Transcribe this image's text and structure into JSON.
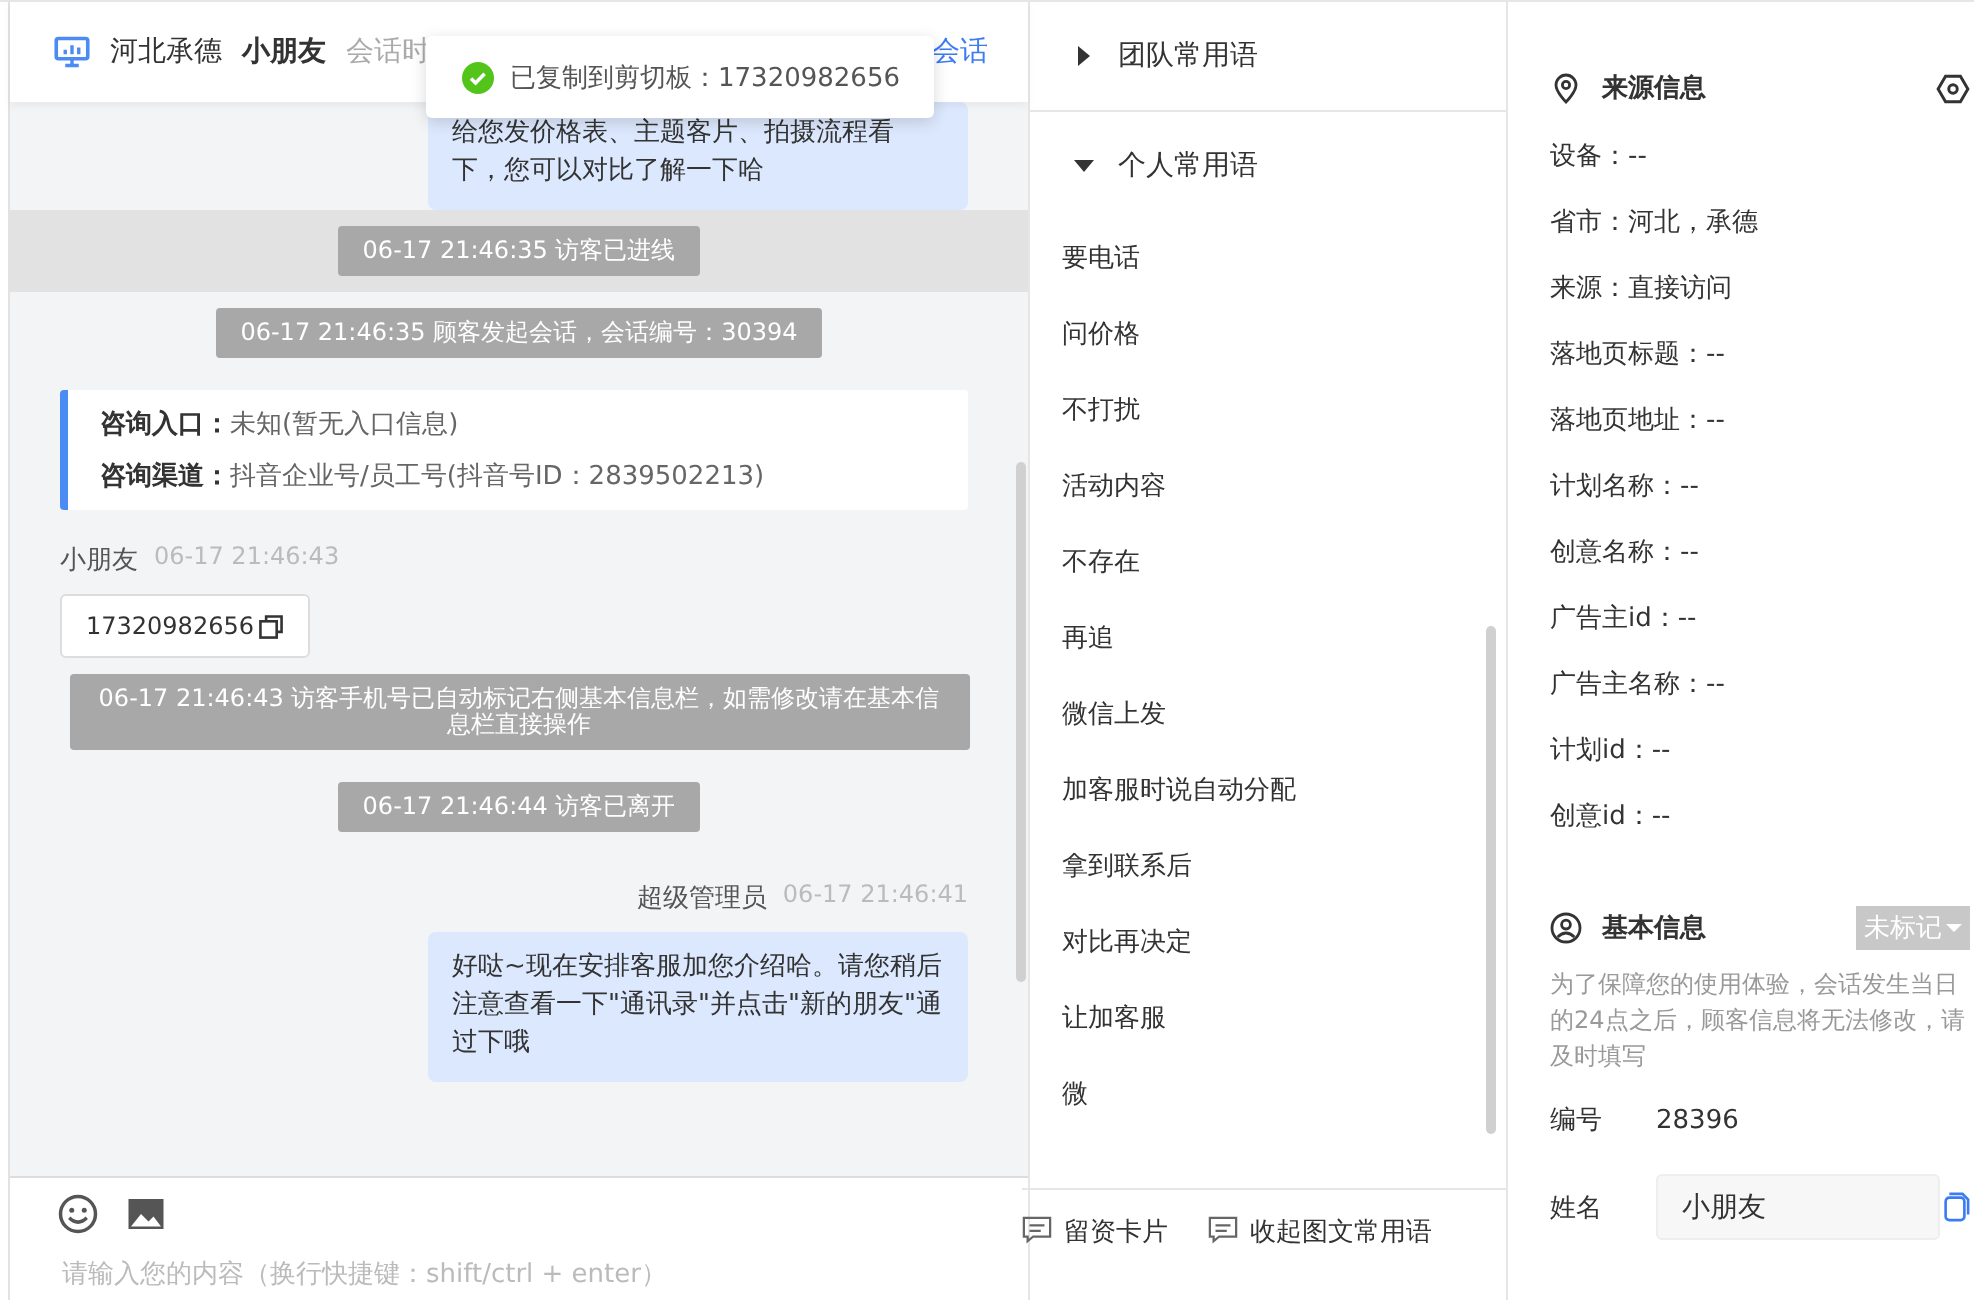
{
  "header": {
    "location": "河北承德",
    "visitor": "小朋友",
    "meta": "会话时",
    "link": "会话"
  },
  "toast": {
    "text": "已复制到剪切板：17320982656"
  },
  "messages": [
    {
      "kind": "agent_bubble",
      "text": "给您发价格表、主题客片、拍摄流程看下，您可以对比了解一下哈"
    },
    {
      "kind": "system",
      "text": "06-17 21:46:35 访客已进线",
      "highlighted": true
    },
    {
      "kind": "system",
      "text": "06-17 21:46:35 顾客发起会话，会话编号：30394",
      "highlighted": false
    },
    {
      "kind": "entry",
      "rows": [
        {
          "label": "咨询入口：",
          "value": "未知(暂无入口信息)"
        },
        {
          "label": "咨询渠道：",
          "value": "抖音企业号/员工号(抖音号ID：2839502213)"
        }
      ]
    },
    {
      "kind": "visitor",
      "name": "小朋友",
      "time": "06-17 21:46:43",
      "text": "17320982656"
    },
    {
      "kind": "system",
      "text": "06-17 21:46:43 访客手机号已自动标记右侧基本信息栏，如需修改请在基本信息栏直接操作",
      "highlighted": false
    },
    {
      "kind": "system",
      "text": "06-17 21:46:44 访客已离开",
      "highlighted": false
    },
    {
      "kind": "agent",
      "name": "超级管理员",
      "time": "06-17 21:46:41",
      "text": "好哒~现在安排客服加您介绍哈。请您稍后注意查看一下\"通讯录\"并点击\"新的朋友\"通过下哦"
    }
  ],
  "composer": {
    "placeholder": "请输入您的内容（换行快捷键：shift/ctrl + enter）"
  },
  "phrases": {
    "groups": [
      {
        "label": "团队常用语",
        "expanded": false
      },
      {
        "label": "个人常用语",
        "expanded": true
      }
    ],
    "items": [
      "要电话",
      "问价格",
      "不打扰",
      "活动内容",
      "不存在",
      "再追",
      "微信上发",
      "加客服时说自动分配",
      "拿到联系后",
      "对比再决定",
      "让加客服",
      "微"
    ],
    "actions": [
      "留资卡片",
      "收起图文常用语"
    ]
  },
  "source": {
    "title": "来源信息",
    "rows": [
      "设备：--",
      "省市：河北，承德",
      "来源：直接访问",
      "落地页标题：--",
      "落地页地址：--",
      "计划名称：--",
      "创意名称：--",
      "广告主id：--",
      "广告主名称：--",
      "计划id：--",
      "创意id：--"
    ]
  },
  "basic": {
    "title": "基本信息",
    "tag": "未标记",
    "note": "为了保障您的使用体验，会话发生当日的24点之后，顾客信息将无法修改，请及时填写",
    "fields": [
      {
        "kind": "text",
        "label": "编号",
        "value": "28396"
      },
      {
        "kind": "input",
        "label": "姓名",
        "value": "小朋友"
      }
    ]
  }
}
